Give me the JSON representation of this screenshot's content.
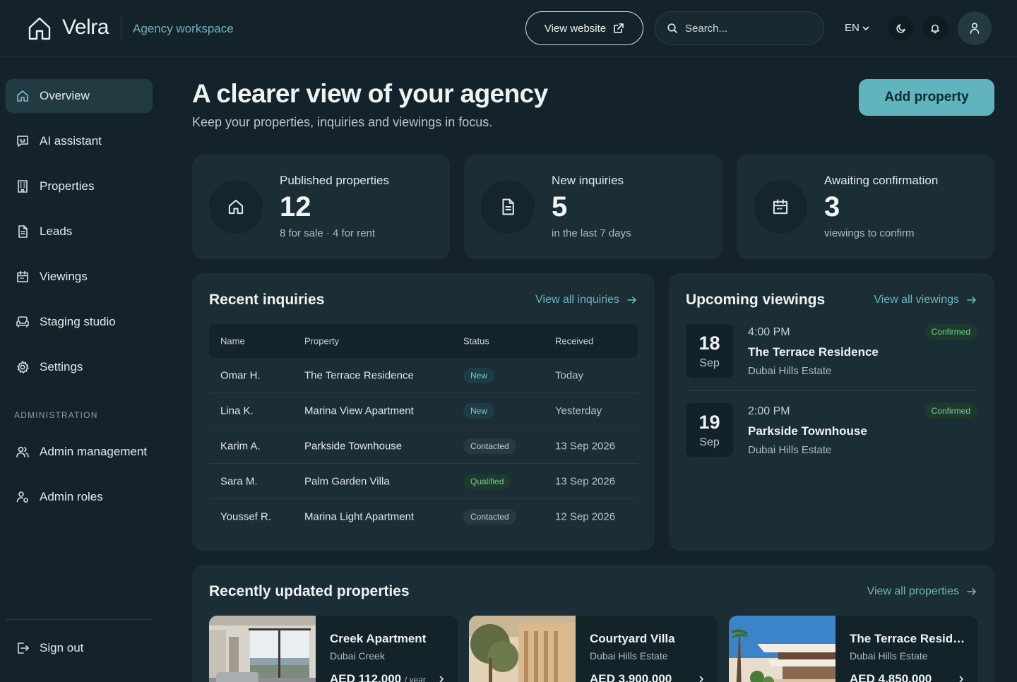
{
  "header": {
    "brand": "Velra",
    "workspace": "Agency workspace",
    "view_website_label": "View website",
    "search_placeholder": "Search...",
    "language": "EN"
  },
  "sidebar": {
    "items": [
      {
        "label": "Overview",
        "icon": "home-icon",
        "active": true
      },
      {
        "label": "AI assistant",
        "icon": "chat-bot-icon"
      },
      {
        "label": "Properties",
        "icon": "building-icon"
      },
      {
        "label": "Leads",
        "icon": "document-icon"
      },
      {
        "label": "Viewings",
        "icon": "calendar-icon"
      },
      {
        "label": "Staging studio",
        "icon": "sofa-icon"
      },
      {
        "label": "Settings",
        "icon": "gear-icon"
      }
    ],
    "section_label": "ADMINISTRATION",
    "admin_items": [
      {
        "label": "Admin management",
        "icon": "users-icon"
      },
      {
        "label": "Admin roles",
        "icon": "user-roles-icon"
      }
    ],
    "sign_out_label": "Sign out"
  },
  "main": {
    "title": "A clearer view of your agency",
    "subtitle": "Keep your properties, inquiries and viewings in focus.",
    "add_property_label": "Add property",
    "stats": [
      {
        "label": "Published properties",
        "value": "12",
        "note": "8 for sale · 4 for rent",
        "icon": "home-icon"
      },
      {
        "label": "New inquiries",
        "value": "5",
        "note": "in the last 7 days",
        "icon": "document-icon"
      },
      {
        "label": "Awaiting confirmation",
        "value": "3",
        "note": "viewings to confirm",
        "icon": "calendar-icon"
      }
    ],
    "inquiries": {
      "title": "Recent inquiries",
      "link": "View all inquiries",
      "columns": [
        "Name",
        "Property",
        "Status",
        "Received"
      ],
      "rows": [
        {
          "name": "Omar H.",
          "property": "The Terrace Residence",
          "status": "New",
          "received": "Today"
        },
        {
          "name": "Lina K.",
          "property": "Marina View Apartment",
          "status": "New",
          "received": "Yesterday"
        },
        {
          "name": "Karim A.",
          "property": "Parkside Townhouse",
          "status": "Contacted",
          "received": "13 Sep 2026"
        },
        {
          "name": "Sara M.",
          "property": "Palm Garden Villa",
          "status": "Qualified",
          "received": "13 Sep 2026"
        },
        {
          "name": "Youssef R.",
          "property": "Marina Light Apartment",
          "status": "Contacted",
          "received": "12 Sep 2026"
        }
      ]
    },
    "viewings": {
      "title": "Upcoming viewings",
      "link": "View all viewings",
      "items": [
        {
          "day": "18",
          "month": "Sep",
          "time": "4:00 PM",
          "property": "The Terrace Residence",
          "area": "Dubai Hills Estate",
          "status": "Confirmed"
        },
        {
          "day": "19",
          "month": "Sep",
          "time": "2:00 PM",
          "property": "Parkside Townhouse",
          "area": "Dubai Hills Estate",
          "status": "Confirmed"
        }
      ]
    },
    "properties": {
      "title": "Recently updated properties",
      "link": "View all properties",
      "items": [
        {
          "name": "Creek Apartment",
          "area": "Dubai Creek",
          "price": "AED 112,000",
          "period": "/ year"
        },
        {
          "name": "Courtyard Villa",
          "area": "Dubai Hills Estate",
          "price": "AED 3,900,000",
          "period": ""
        },
        {
          "name": "The Terrace Residence",
          "area": "Dubai Hills Estate",
          "price": "AED 4,850,000",
          "period": ""
        }
      ]
    }
  },
  "colors": {
    "background": "#14232b",
    "card": "#1b2d35",
    "accent": "#5fb4bd",
    "link": "#6fb4bd",
    "confirmed": "#6fcf8f"
  }
}
